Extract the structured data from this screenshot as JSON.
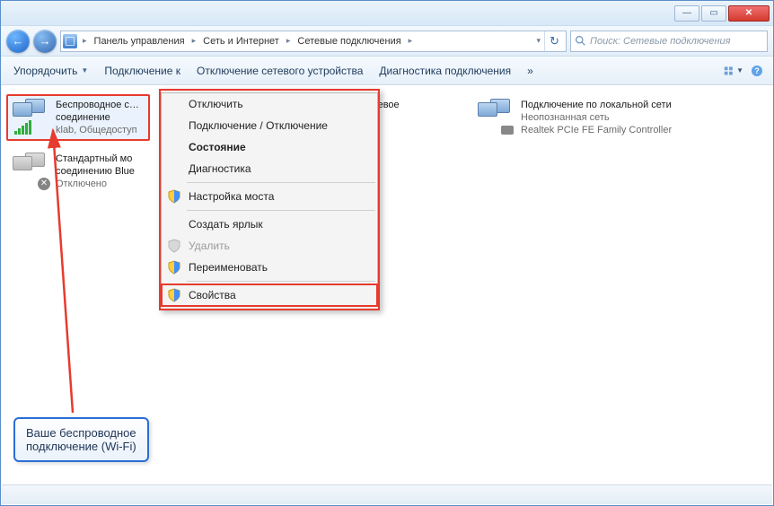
{
  "titlebar": {
    "minimize": "—",
    "maximize": "▭",
    "close": "✕"
  },
  "nav": {
    "back": "←",
    "forward": "→",
    "segments": [
      "Панель управления",
      "Сеть и Интернет",
      "Сетевые подключения"
    ],
    "refresh": "↻",
    "dropdown": "▾"
  },
  "search": {
    "placeholder": "Поиск: Сетевые подключения"
  },
  "toolbar": {
    "organize": "Упорядочить",
    "connect": "Подключение к",
    "disable": "Отключение сетевого устройства",
    "diagnose": "Диагностика подключения",
    "chev": "»"
  },
  "connections": [
    {
      "id": "wifi",
      "line1": "Беспроводное сетевое",
      "line2": "соединение",
      "line3": "klab, Общедоступ",
      "selected": true,
      "signal": true
    },
    {
      "id": "wifi2",
      "line1": "Беспроводное сетевое",
      "line2": "",
      "line3": "",
      "selected": false,
      "signal": true
    },
    {
      "id": "lan",
      "line1": "Подключение по локальной сети",
      "line2": "Неопознанная сеть",
      "line3": "Realtek PCIe FE Family Controller",
      "selected": false,
      "plug": true
    },
    {
      "id": "bt",
      "line1": "Стандартный мо",
      "line2": "соединению Blue",
      "line3": "Отключено",
      "selected": false,
      "disabled": true
    }
  ],
  "context_menu": [
    {
      "label": "Отключить",
      "bold": false
    },
    {
      "label": "Подключение / Отключение",
      "bold": false
    },
    {
      "label": "Состояние",
      "bold": true
    },
    {
      "label": "Диагностика",
      "bold": false
    },
    {
      "sep": true
    },
    {
      "label": "Настройка моста",
      "shield": true
    },
    {
      "sep": true
    },
    {
      "label": "Создать ярлык",
      "bold": false
    },
    {
      "label": "Удалить",
      "shield": true,
      "disabled": true
    },
    {
      "label": "Переименовать",
      "shield": true
    },
    {
      "sep": true
    },
    {
      "label": "Свойства",
      "shield": true,
      "highlighted": true
    }
  ],
  "callout": {
    "line1": "Ваше беспроводное",
    "line2": "подключение (Wi-Fi)"
  }
}
